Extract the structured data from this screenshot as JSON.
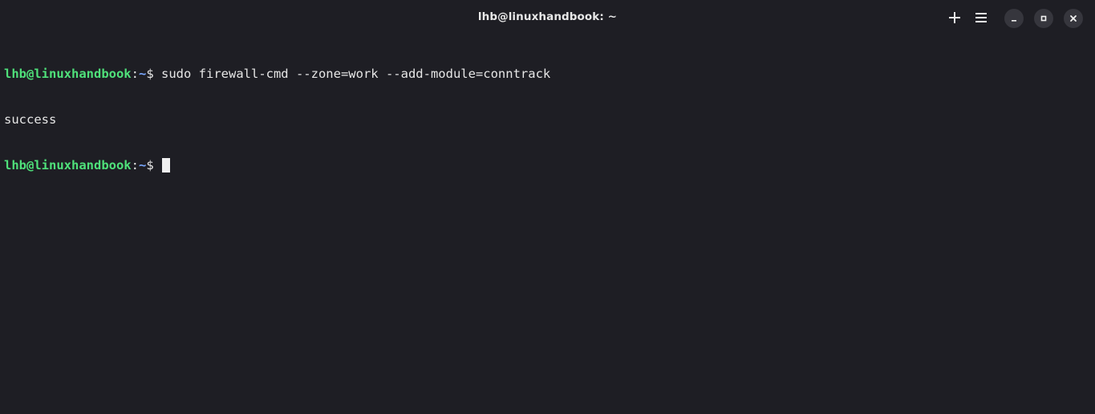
{
  "window": {
    "title": "lhb@linuxhandbook: ~"
  },
  "titlebar": {
    "icons": [
      "plus-icon",
      "hamburger-menu-icon",
      "minimize-icon",
      "maximize-icon",
      "close-icon"
    ]
  },
  "terminal": {
    "lines": [
      {
        "user_host": "lhb@linuxhandbook",
        "colon": ":",
        "path": "~",
        "dollar": "$ ",
        "command": "sudo firewall-cmd --zone=work --add-module=conntrack"
      },
      {
        "output": "success"
      },
      {
        "user_host": "lhb@linuxhandbook",
        "colon": ":",
        "path": "~",
        "dollar": "$ ",
        "command": ""
      }
    ]
  },
  "colors": {
    "background": "#1e1e24",
    "prompt_user": "#4fe07a",
    "prompt_path": "#7aa8ff",
    "text": "#e6e6e6"
  }
}
